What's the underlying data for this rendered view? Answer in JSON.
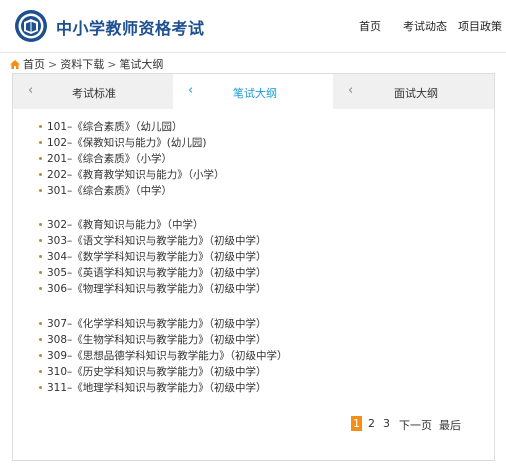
{
  "header": {
    "site_title": "中小学教师资格考试",
    "nav": [
      "首页",
      "考试动态",
      "项目政策"
    ]
  },
  "breadcrumb": {
    "home": "首页",
    "sep": ">",
    "level2": "资料下载",
    "level3": "笔试大纲"
  },
  "tabs": [
    {
      "label": "考试标准",
      "chevron": "‹"
    },
    {
      "label": "笔试大纲",
      "chevron": "‹"
    },
    {
      "label": "面试大纲",
      "chevron": "‹"
    }
  ],
  "items": [
    "101–《综合素质》（幼儿园）",
    "102–《保教知识与能力》(幼儿园)",
    "201–《综合素质》（小学）",
    "202–《教育教学知识与能力》（小学）",
    "301–《综合素质》（中学）",
    "302–《教育知识与能力》（中学）",
    "303–《语文学科知识与教学能力》（初级中学）",
    "304–《数学学科知识与教学能力》（初级中学）",
    "305–《英语学科知识与教学能力》（初级中学）",
    "306–《物理学科知识与教学能力》（初级中学）",
    "307–《化学学科知识与教学能力》（初级中学）",
    "308–《生物学科知识与教学能力》（初级中学）",
    "309–《思想品德学科知识与教学能力》（初级中学）",
    "310–《历史学科知识与教学能力》（初级中学）",
    "311–《地理学科知识与教学能力》（初级中学）"
  ],
  "pagination": {
    "pages": [
      "1",
      "2",
      "3"
    ],
    "current": "1",
    "next": "下一页",
    "last": "最后"
  },
  "colors": {
    "brand": "#1d4f91",
    "active_tab": "#1a9bd7",
    "current_page": "#f58e14",
    "bullet": "#b38b3a"
  }
}
